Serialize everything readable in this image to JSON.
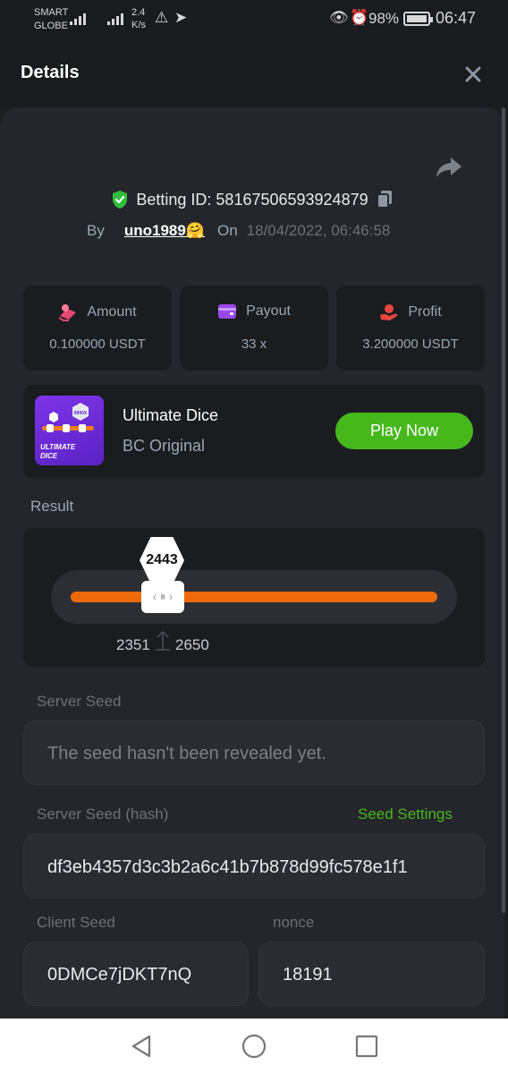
{
  "status_bar": {
    "carrier_line1": "SMART",
    "carrier_line2": "GLOBE",
    "network": "4G",
    "speed_value": "2.4",
    "speed_unit": "K/s",
    "battery": "98%",
    "time": "06:47"
  },
  "header": {
    "title": "Details",
    "close_icon": "close-icon"
  },
  "bet": {
    "id_label": "Betting ID: 58167506593924879",
    "by_label": "By",
    "user": "uno1989🤗",
    "on_label": "On",
    "date": "18/04/2022, 06:46:58"
  },
  "stats": [
    {
      "label": "Amount",
      "value": "0.100000 USDT",
      "icon": "money-icon",
      "color": "#e9486f"
    },
    {
      "label": "Payout",
      "value": "33 x",
      "icon": "wallet-icon",
      "color": "#9b46ea"
    },
    {
      "label": "Profit",
      "value": "3.200000 USDT",
      "icon": "hand-coin-icon",
      "color": "#e8473d"
    }
  ],
  "game": {
    "name": "Ultimate Dice",
    "subtitle": "BC Original",
    "play_label": "Play Now",
    "thumb_title_line1": "ULTIMATE",
    "thumb_title_line2": "DICE",
    "thumb_badge": "9900X"
  },
  "result": {
    "label": "Result",
    "value": "2443",
    "range_low": "2351",
    "range_high": "2650",
    "accent": "#ec6a0b"
  },
  "seeds": {
    "server_seed_label": "Server Seed",
    "server_seed_value": "The seed hasn't been revealed yet.",
    "server_hash_label": "Server Seed (hash)",
    "seed_settings_label": "Seed Settings",
    "server_hash_value": "df3eb4357d3c3b2a6c41b7b878d99fc578e1f1",
    "client_seed_label": "Client Seed",
    "client_seed_value": "0DMCe7jDKT7nQ",
    "nonce_label": "nonce",
    "nonce_value": "18191"
  },
  "colors": {
    "accent_green": "#47b81b",
    "background": "#24262b"
  }
}
